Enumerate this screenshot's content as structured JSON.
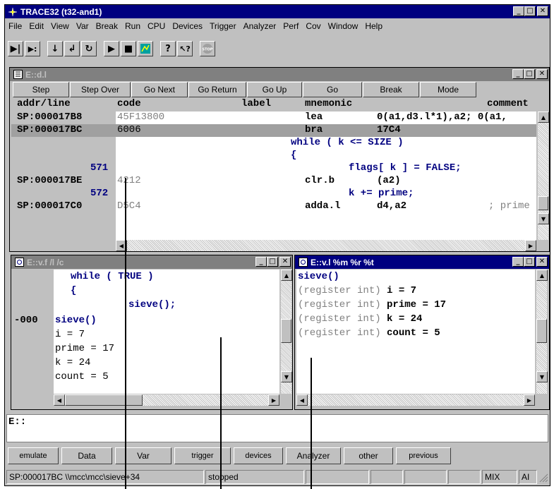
{
  "app": {
    "title": "TRACE32 (t32-and1)"
  },
  "menu": [
    "File",
    "Edit",
    "View",
    "Var",
    "Break",
    "Run",
    "CPU",
    "Devices",
    "Trigger",
    "Analyzer",
    "Perf",
    "Cov",
    "Window",
    "Help"
  ],
  "toolbar": {
    "icons": [
      "step-icon",
      "step-into-icon",
      "step-over-icon",
      "return-icon",
      "go-back-icon",
      "go-icon",
      "stop-icon",
      "window-icon",
      "help-icon",
      "context-help-icon",
      "stop-target-icon"
    ]
  },
  "list_window": {
    "title": "E::d.l",
    "buttons": [
      "Step",
      "Step Over",
      "Go Next",
      "Go Return",
      "Go Up",
      "Go",
      "Break",
      "Mode"
    ],
    "headers": {
      "addr": "addr/line",
      "code": "code",
      "label": "label",
      "mnemonic": "mnemonic",
      "comment": "comment"
    },
    "rows": [
      {
        "addr": "SP:000017B8",
        "code": "45F13800",
        "mnemonic": "lea",
        "operand": "0(a1,d3.l*1),a2; 0(a1,",
        "selected": false
      },
      {
        "addr": "SP:000017BC",
        "code": "6006",
        "mnemonic": "bra",
        "operand": "17C4",
        "selected": true
      },
      {
        "src": "while ( k <= SIZE )"
      },
      {
        "src": "{"
      },
      {
        "line": "571",
        "src": "flags[ k ] = FALSE;"
      },
      {
        "addr": "SP:000017BE",
        "code": "4212",
        "mnemonic": "clr.b",
        "operand": "(a2)"
      },
      {
        "line": "572",
        "src": "k += prime;"
      },
      {
        "addr": "SP:000017C0",
        "code": "D5C4",
        "mnemonic": "adda.l",
        "operand": "d4,a2",
        "comment": "; prime"
      }
    ]
  },
  "frame_window": {
    "title": "E::v.f /l /c",
    "lines": [
      {
        "gutter": "",
        "text": "while ( TRUE )",
        "style": "src"
      },
      {
        "gutter": "",
        "text": "{",
        "style": "src"
      },
      {
        "gutter": "",
        "text": "sieve();",
        "style": "src"
      },
      {
        "gutter": "-000",
        "text": "sieve()",
        "style": "fn"
      },
      {
        "gutter": "",
        "text": "i = 7",
        "style": "plain"
      },
      {
        "gutter": "",
        "text": "prime = 17",
        "style": "plain"
      },
      {
        "gutter": "",
        "text": "k = 24",
        "style": "plain"
      },
      {
        "gutter": "",
        "text": "count = 5",
        "style": "plain"
      }
    ]
  },
  "locals_window": {
    "title": "E::v.l %m %r %t",
    "function": "sieve()",
    "vars": [
      {
        "type": "(register int)",
        "expr": "i = 7"
      },
      {
        "type": "(register int)",
        "expr": "prime = 17"
      },
      {
        "type": "(register int)",
        "expr": "k = 24"
      },
      {
        "type": "(register int)",
        "expr": "count = 5"
      }
    ]
  },
  "command": {
    "prompt": "E::"
  },
  "softkeys": [
    "emulate",
    "Data",
    "Var",
    "trigger",
    "devices",
    "Analyzer",
    "other",
    "previous"
  ],
  "status": {
    "location": "SP:000017BC  \\\\mcc\\mcc\\sieve+34",
    "state": "stopped",
    "mode": "MIX",
    "ai": "AI"
  }
}
